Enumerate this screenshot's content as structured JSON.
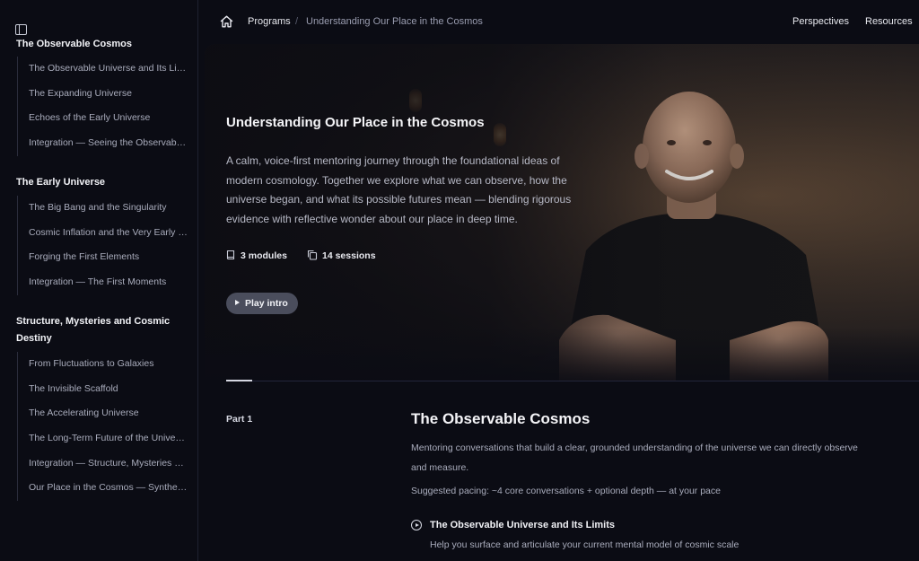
{
  "sidebar": {
    "groups": [
      {
        "title": "The Observable Cosmos",
        "items": [
          "The Observable Universe and Its Limits",
          "The Expanding Universe",
          "Echoes of the Early Universe",
          "Integration — Seeing the Observable Cosmos"
        ]
      },
      {
        "title": "The Early Universe",
        "items": [
          "The Big Bang and the Singularity",
          "Cosmic Inflation and the Very Early Universe",
          "Forging the First Elements",
          "Integration — The First Moments"
        ]
      },
      {
        "title": "Structure, Mysteries and Cosmic Destiny",
        "items": [
          "From Fluctuations to Galaxies",
          "The Invisible Scaffold",
          "The Accelerating Universe",
          "The Long-Term Future of the Universe",
          "Integration — Structure, Mysteries and Destiny",
          "Our Place in the Cosmos — Synthesis"
        ]
      }
    ]
  },
  "header": {
    "breadcrumb_programs": "Programs",
    "breadcrumb_separator": "/",
    "breadcrumb_current": "Understanding Our Place in the Cosmos",
    "nav_perspectives": "Perspectives",
    "nav_resources": "Resources"
  },
  "hero": {
    "title": "Understanding Our Place in the Cosmos",
    "description": "A calm, voice-first mentoring journey through the foundational ideas of modern cosmology. Together we explore what we can observe, how the universe began, and what its possible futures mean — blending rigorous evidence with reflective wonder about our place in deep time.",
    "modules": "3 modules",
    "sessions": "14 sessions",
    "play_label": "Play intro"
  },
  "part": {
    "label": "Part 1",
    "title": "The Observable Cosmos",
    "description": "Mentoring conversations that build a clear, grounded understanding of the universe we can directly observe and measure.",
    "pacing": "Suggested pacing: ~4 core conversations + optional depth — at your pace",
    "session_title": "The Observable Universe and Its Limits",
    "session_desc": "Help you surface and articulate your current mental model of cosmic scale"
  },
  "colors": {
    "background": "#0b0c14",
    "accent_button": "#4a4d5c",
    "text_primary": "#f4f4f7",
    "text_muted": "#a9acbc"
  }
}
